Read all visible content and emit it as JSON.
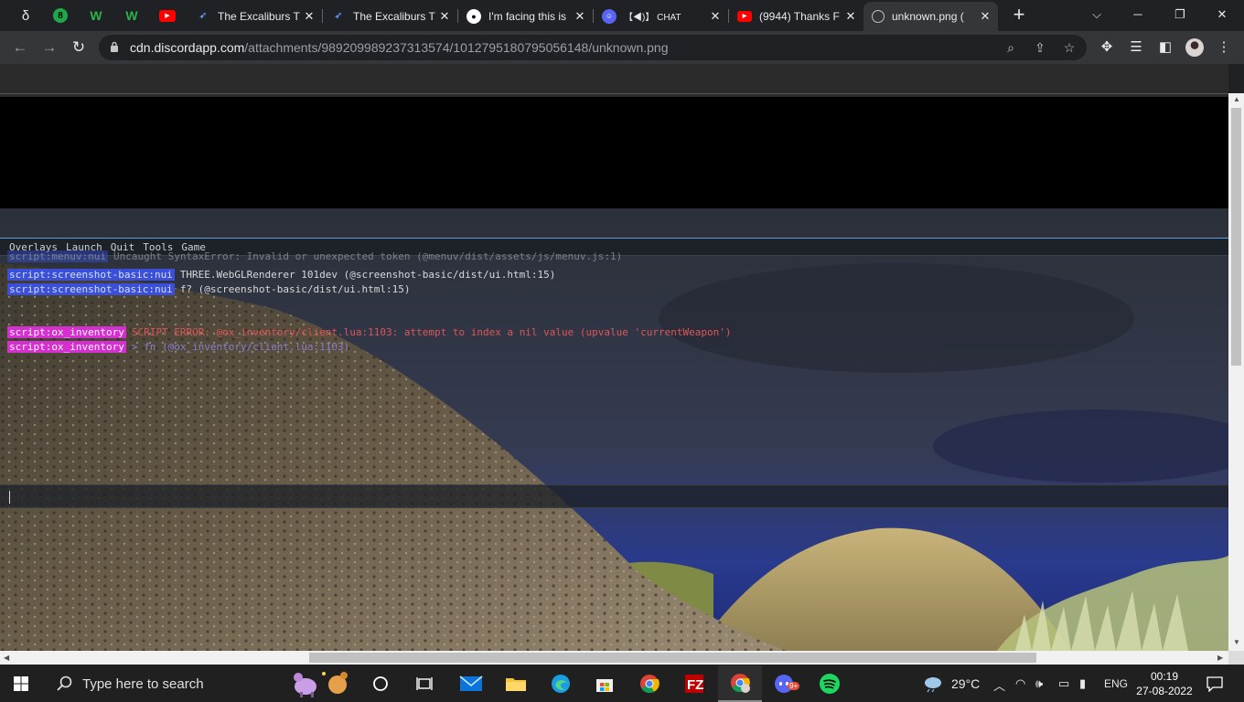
{
  "browser": {
    "pinned_tabs": [
      {
        "icon": "delta-icon",
        "glyph": "δ"
      },
      {
        "icon": "green-8-icon",
        "glyph": "8"
      },
      {
        "icon": "w-logo-icon",
        "glyph": "W"
      },
      {
        "icon": "w-logo-icon",
        "glyph": "W"
      },
      {
        "icon": "youtube-icon",
        "glyph": "▶"
      }
    ],
    "tabs": [
      {
        "title": "The Excaliburs T",
        "icon": "excaliburs-icon"
      },
      {
        "title": "The Excaliburs T",
        "icon": "excaliburs-icon"
      },
      {
        "title": "I'm facing this is",
        "icon": "github-icon"
      },
      {
        "title": "【◀)】 CHAT",
        "icon": "discord-icon"
      },
      {
        "title": "(9944) Thanks F",
        "icon": "youtube-icon"
      },
      {
        "title": "unknown.png (",
        "icon": "globe-icon"
      }
    ],
    "new_tab_glyph": "+",
    "url_host": "cdn.discordapp.com",
    "url_path": "/attachments/989209989237313574/1012795180795056148/unknown.png"
  },
  "game": {
    "menu": [
      "Overlays",
      "Launch",
      "Quit",
      "Tools",
      "Game"
    ],
    "console_lines": [
      {
        "channel": "script:menuv:nui",
        "color": "blue",
        "message": "Uncaught SyntaxError: Invalid or unexpected token (@menuv/dist/assets/js/menuv.js:1)",
        "style": "dim"
      },
      {
        "channel": "script:screenshot-basic:nui",
        "color": "blue",
        "message": "THREE.WebGLRenderer 101dev (@screenshot-basic/dist/ui.html:15)",
        "style": "normal"
      },
      {
        "channel": "script:screenshot-basic:nui",
        "color": "blue",
        "message": "f? (@screenshot-basic/dist/ui.html:15)",
        "style": "normal"
      },
      {
        "channel": "script:ox_inventory",
        "color": "pink",
        "message": "SCRIPT ERROR: @ox_inventory/client.lua:1103: attempt to index a nil value (upvalue 'currentWeapon')",
        "style": "err"
      },
      {
        "channel": "script:ox_inventory",
        "color": "pink",
        "message": "> fn (@ox_inventory/client.lua:1103)",
        "style": "dim"
      }
    ]
  },
  "taskbar": {
    "search_placeholder": "Type here to search",
    "weather_temp": "29°C",
    "language": "ENG",
    "time": "00:19",
    "date": "27-08-2022",
    "discord_badge": "9+"
  }
}
